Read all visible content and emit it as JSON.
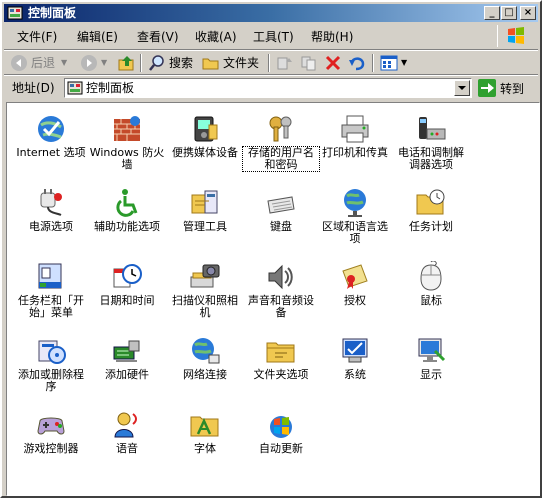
{
  "window": {
    "title": "控制面板"
  },
  "title_buttons": {
    "minimize": "_",
    "maximize": "□",
    "close": "×"
  },
  "menu": [
    "文件(F)",
    "编辑(E)",
    "查看(V)",
    "收藏(A)",
    "工具(T)",
    "帮助(H)"
  ],
  "toolbar": {
    "back": "后退",
    "search": "搜索",
    "folders": "文件夹"
  },
  "address": {
    "label": "地址(D)",
    "value": "控制面板",
    "go": "转到"
  },
  "items": [
    {
      "label": "Internet 选项",
      "icon": "globe-check-icon"
    },
    {
      "label": "Windows 防火墙",
      "icon": "firewall-icon"
    },
    {
      "label": "便携媒体设备",
      "icon": "media-device-icon"
    },
    {
      "label": "存储的用户名和密码",
      "icon": "keys-icon"
    },
    {
      "label": "打印机和传真",
      "icon": "printer-icon"
    },
    {
      "label": "电话和调制解调器选项",
      "icon": "phone-modem-icon"
    },
    {
      "label": "电源选项",
      "icon": "power-plug-icon"
    },
    {
      "label": "辅助功能选项",
      "icon": "accessibility-icon"
    },
    {
      "label": "管理工具",
      "icon": "admin-tools-icon"
    },
    {
      "label": "键盘",
      "icon": "keyboard-icon"
    },
    {
      "label": "区域和语言选项",
      "icon": "globe-icon"
    },
    {
      "label": "任务计划",
      "icon": "task-folder-icon"
    },
    {
      "label": "任务栏和「开始」菜单",
      "icon": "taskbar-icon"
    },
    {
      "label": "日期和时间",
      "icon": "calendar-clock-icon"
    },
    {
      "label": "扫描仪和照相机",
      "icon": "scanner-camera-icon"
    },
    {
      "label": "声音和音频设备",
      "icon": "speaker-icon"
    },
    {
      "label": "授权",
      "icon": "certificate-icon"
    },
    {
      "label": "鼠标",
      "icon": "mouse-icon"
    },
    {
      "label": "添加或删除程序",
      "icon": "add-remove-programs-icon"
    },
    {
      "label": "添加硬件",
      "icon": "add-hardware-icon"
    },
    {
      "label": "网络连接",
      "icon": "network-icon"
    },
    {
      "label": "文件夹选项",
      "icon": "folder-options-icon"
    },
    {
      "label": "系统",
      "icon": "system-icon"
    },
    {
      "label": "显示",
      "icon": "display-icon"
    },
    {
      "label": "游戏控制器",
      "icon": "gamepad-icon"
    },
    {
      "label": "语音",
      "icon": "speech-icon"
    },
    {
      "label": "字体",
      "icon": "fonts-folder-icon"
    },
    {
      "label": "自动更新",
      "icon": "windows-update-icon"
    }
  ],
  "selected_item": "存储的用户名和密码"
}
